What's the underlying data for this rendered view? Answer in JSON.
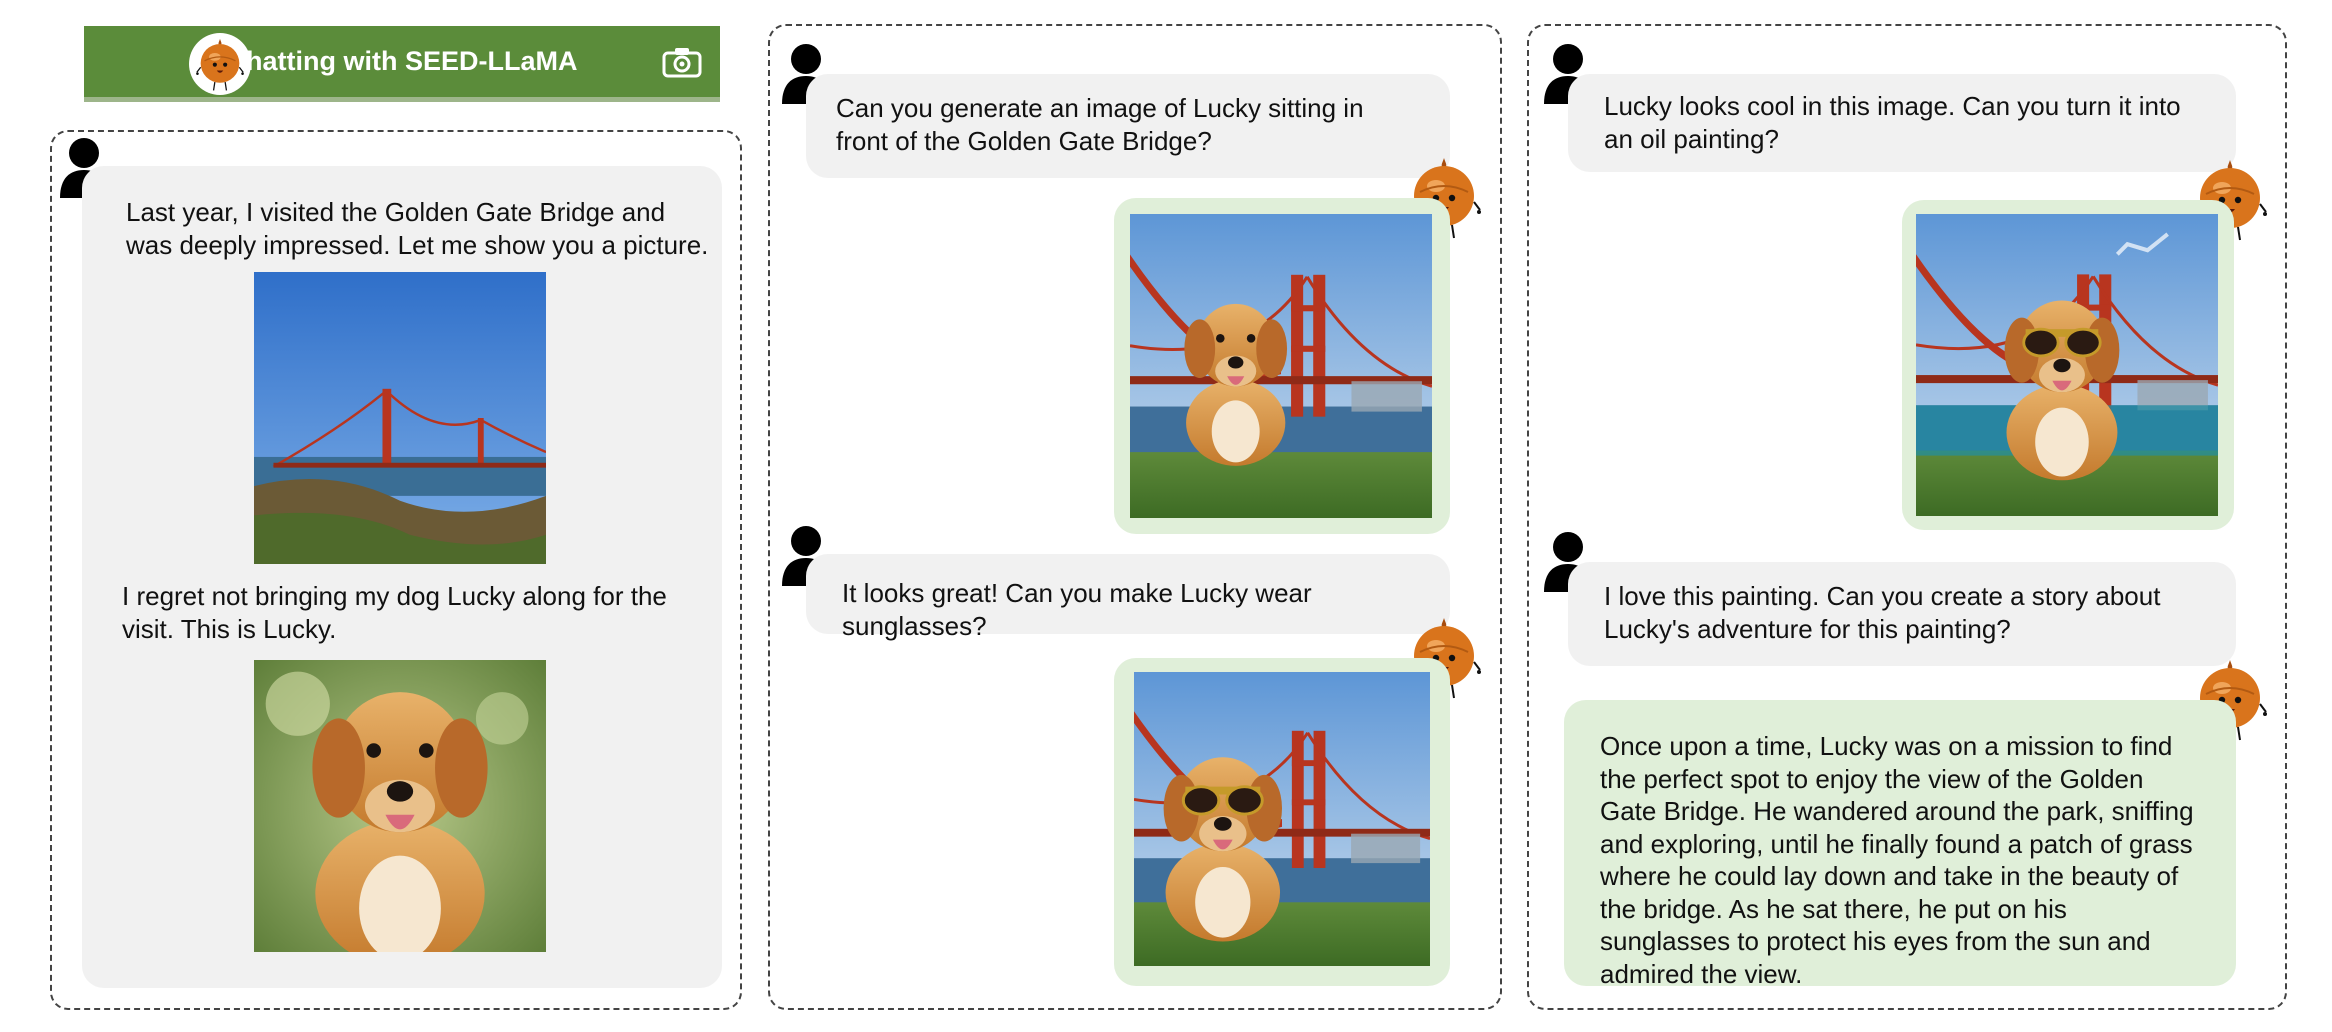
{
  "banner": {
    "title": "Chatting with SEED-LLaMA",
    "color": "#5b8c3a"
  },
  "panel1": {
    "message_part1": "Last year, I visited the Golden Gate Bridge and was deeply impressed. Let me show you a picture.",
    "message_part2": "I regret not bringing my dog Lucky along for the visit. This is Lucky.",
    "images": [
      "golden-gate-photo",
      "golden-retriever-photo"
    ]
  },
  "panel2": {
    "user_message_1": "Can you generate an image of Lucky sitting in front of the Golden Gate Bridge?",
    "user_message_2": "It looks great! Can you make Lucky wear sunglasses?",
    "images": [
      "lucky-bridge-generated",
      "lucky-sunglasses-generated"
    ]
  },
  "panel3": {
    "user_message_1": "Lucky looks cool in this image. Can you turn it into an oil painting?",
    "user_message_2": "I love this painting. Can you create a story about Lucky's adventure for this painting?",
    "bot_story": "Once upon a time, Lucky was on a mission to find the perfect spot to enjoy the view of the Golden Gate Bridge. He wandered around the park, sniffing and exploring, until he finally found a patch of grass where he could lay down and take in the beauty of the bridge. As he sat there, he put on his sunglasses to protect his eyes from the sun and admired the view.",
    "images": [
      "lucky-oil-painting"
    ]
  },
  "icons": [
    "user-avatar-icon",
    "seed-mascot-icon",
    "camera-icon"
  ],
  "colors": {
    "user_bubble": "#f1f1f1",
    "bot_bubble": "#e0efd9",
    "banner": "#5b8c3a"
  }
}
